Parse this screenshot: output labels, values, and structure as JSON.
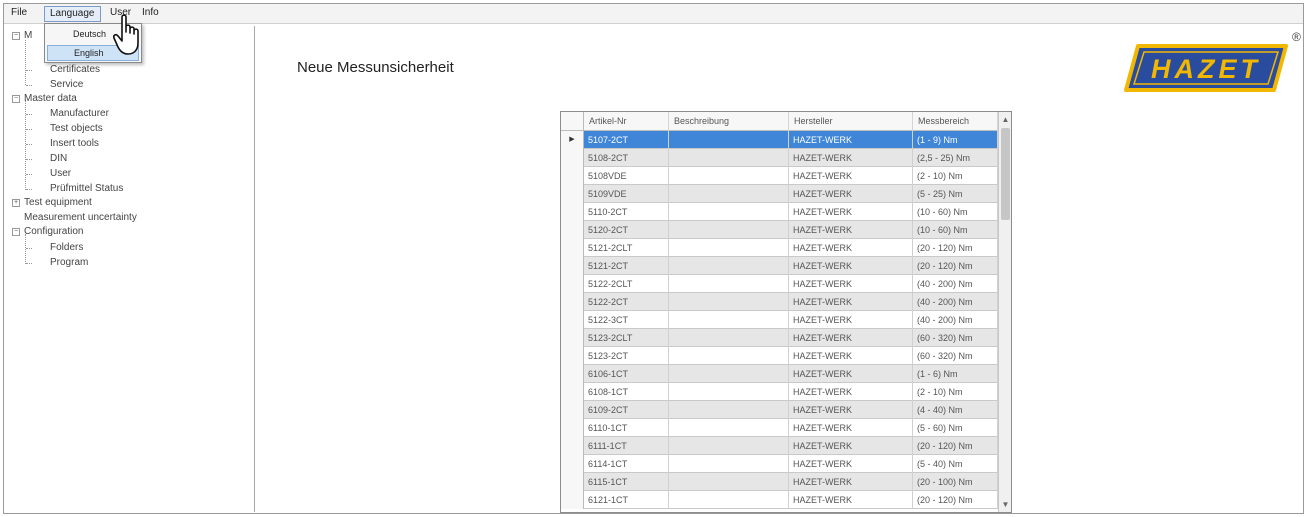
{
  "menubar": {
    "items": [
      {
        "label": "File"
      },
      {
        "label": "Language"
      },
      {
        "label": "User"
      },
      {
        "label": "Info"
      }
    ]
  },
  "language_menu": {
    "items": [
      {
        "label": "Deutsch"
      },
      {
        "label": "English",
        "selected": true
      }
    ]
  },
  "tree": {
    "nodes": [
      {
        "label": "M"
      },
      {
        "label": "Certificates"
      },
      {
        "label": "Service"
      },
      {
        "label": "Master data"
      },
      {
        "label": "Manufacturer"
      },
      {
        "label": "Test objects"
      },
      {
        "label": "Insert tools"
      },
      {
        "label": "DIN"
      },
      {
        "label": "User"
      },
      {
        "label": "Prüfmittel Status"
      },
      {
        "label": "Test equipment"
      },
      {
        "label": "Measurement uncertainty"
      },
      {
        "label": "Configuration"
      },
      {
        "label": "Folders"
      },
      {
        "label": "Program"
      }
    ]
  },
  "main": {
    "title": "Neue Messunsicherheit"
  },
  "logo": {
    "text": "HAZET",
    "registered": "®",
    "colors": {
      "background": "#2a4c9e",
      "accent": "#f2b700"
    }
  },
  "grid": {
    "columns": [
      "Artikel-Nr",
      "Beschreibung",
      "Hersteller",
      "Messbereich"
    ],
    "selected_marker": "▶",
    "selected_row": 0,
    "scroll_up": "▲",
    "scroll_down": "▼",
    "rows": [
      {
        "artikel": "5107-2CT",
        "beschreibung": "",
        "hersteller": "HAZET-WERK",
        "messbereich": "(1 - 9) Nm"
      },
      {
        "artikel": "5108-2CT",
        "beschreibung": "",
        "hersteller": "HAZET-WERK",
        "messbereich": "(2,5 - 25) Nm"
      },
      {
        "artikel": "5108VDE",
        "beschreibung": "",
        "hersteller": "HAZET-WERK",
        "messbereich": "(2 - 10) Nm"
      },
      {
        "artikel": "5109VDE",
        "beschreibung": "",
        "hersteller": "HAZET-WERK",
        "messbereich": "(5 - 25) Nm"
      },
      {
        "artikel": "5110-2CT",
        "beschreibung": "",
        "hersteller": "HAZET-WERK",
        "messbereich": "(10 - 60) Nm"
      },
      {
        "artikel": "5120-2CT",
        "beschreibung": "",
        "hersteller": "HAZET-WERK",
        "messbereich": "(10 - 60) Nm"
      },
      {
        "artikel": "5121-2CLT",
        "beschreibung": "",
        "hersteller": "HAZET-WERK",
        "messbereich": "(20 - 120) Nm"
      },
      {
        "artikel": "5121-2CT",
        "beschreibung": "",
        "hersteller": "HAZET-WERK",
        "messbereich": "(20 - 120) Nm"
      },
      {
        "artikel": "5122-2CLT",
        "beschreibung": "",
        "hersteller": "HAZET-WERK",
        "messbereich": "(40 - 200) Nm"
      },
      {
        "artikel": "5122-2CT",
        "beschreibung": "",
        "hersteller": "HAZET-WERK",
        "messbereich": "(40 - 200) Nm"
      },
      {
        "artikel": "5122-3CT",
        "beschreibung": "",
        "hersteller": "HAZET-WERK",
        "messbereich": "(40 - 200) Nm"
      },
      {
        "artikel": "5123-2CLT",
        "beschreibung": "",
        "hersteller": "HAZET-WERK",
        "messbereich": "(60 - 320) Nm"
      },
      {
        "artikel": "5123-2CT",
        "beschreibung": "",
        "hersteller": "HAZET-WERK",
        "messbereich": "(60 - 320) Nm"
      },
      {
        "artikel": "6106-1CT",
        "beschreibung": "",
        "hersteller": "HAZET-WERK",
        "messbereich": "(1 - 6) Nm"
      },
      {
        "artikel": "6108-1CT",
        "beschreibung": "",
        "hersteller": "HAZET-WERK",
        "messbereich": "(2 - 10) Nm"
      },
      {
        "artikel": "6109-2CT",
        "beschreibung": "",
        "hersteller": "HAZET-WERK",
        "messbereich": "(4 - 40) Nm"
      },
      {
        "artikel": "6110-1CT",
        "beschreibung": "",
        "hersteller": "HAZET-WERK",
        "messbereich": "(5 - 60) Nm"
      },
      {
        "artikel": "6111-1CT",
        "beschreibung": "",
        "hersteller": "HAZET-WERK",
        "messbereich": "(20 - 120) Nm"
      },
      {
        "artikel": "6114-1CT",
        "beschreibung": "",
        "hersteller": "HAZET-WERK",
        "messbereich": "(5 - 40) Nm"
      },
      {
        "artikel": "6115-1CT",
        "beschreibung": "",
        "hersteller": "HAZET-WERK",
        "messbereich": "(20 - 100) Nm"
      },
      {
        "artikel": "6121-1CT",
        "beschreibung": "",
        "hersteller": "HAZET-WERK",
        "messbereich": "(20 - 120) Nm"
      }
    ]
  }
}
